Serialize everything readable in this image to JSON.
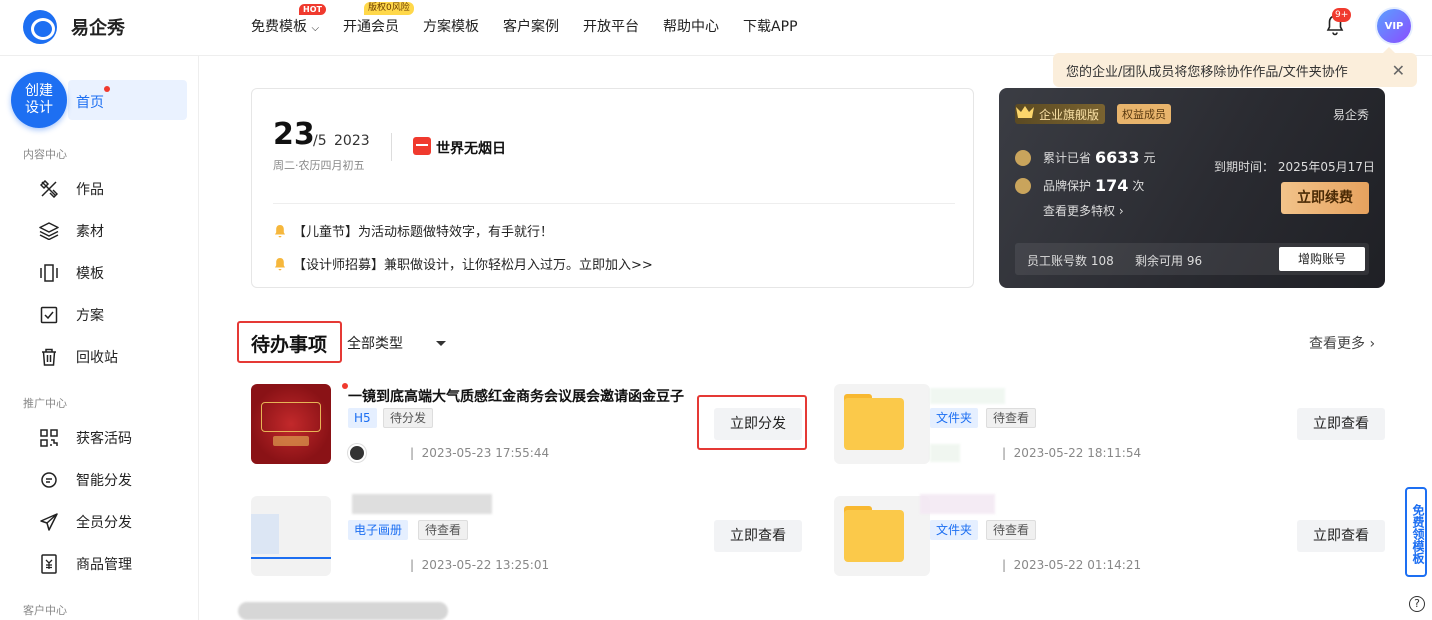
{
  "app": {
    "name": "易企秀"
  },
  "nav": [
    {
      "label": "免费模板",
      "badge": "HOT"
    },
    {
      "label": "开通会员",
      "badge": "版权0风险"
    },
    {
      "label": "方案模板"
    },
    {
      "label": "客户案例"
    },
    {
      "label": "开放平台"
    },
    {
      "label": "帮助中心"
    },
    {
      "label": "下载APP"
    }
  ],
  "header": {
    "bell_badge": "9+",
    "avatar_label": "VIP"
  },
  "tip": {
    "text": "您的企业/团队成员将您移除协作作品/文件夹协作",
    "close": "✕"
  },
  "sidebar": {
    "create_label": "创建设计",
    "create_line1": "创建",
    "create_line2": "设计",
    "home": "首页",
    "sections": [
      {
        "title": "内容中心",
        "items": [
          "作品",
          "素材",
          "模板",
          "方案",
          "回收站"
        ]
      },
      {
        "title": "推广中心",
        "items": [
          "获客活码",
          "智能分发",
          "全员分发",
          "商品管理"
        ]
      },
      {
        "title": "客户中心",
        "items": []
      }
    ]
  },
  "date_card": {
    "day": "23",
    "month": "/5",
    "year": "2023",
    "lunar": "周二·农历四月初五",
    "festival": "世界无烟日",
    "notices": [
      "【儿童节】为活动标题做特效字，有手就行！",
      "【设计师招募】兼职做设计，让你轻松月入过万。立即加入>>"
    ]
  },
  "vip": {
    "tag": "企业旗舰版",
    "tag2": "权益成员",
    "brand": "易企秀",
    "saved_label": "累计已省",
    "saved_value": "6633",
    "saved_unit": "元",
    "protect_label": "品牌保护",
    "protect_value": "174",
    "protect_unit": "次",
    "more": "查看更多特权 ›",
    "expire": "到期时间：  2025年05月17日",
    "renew": "立即续费",
    "staff": "员工账号数 108",
    "remain": "剩余可用 96",
    "buy": "增购账号"
  },
  "todo": {
    "title": "待办事项",
    "type_filter": "全部类型",
    "more": "查看更多 ›",
    "items": [
      {
        "title": "一镜到底高端大气质感红金商务会议展会邀请函金豆子",
        "tags": [
          "H5",
          "待分发"
        ],
        "time": "2023-05-23 17:55:44",
        "action": "立即分发"
      },
      {
        "title": "",
        "tags": [
          "文件夹",
          "待查看"
        ],
        "time": "2023-05-22 18:11:54",
        "action": "立即查看"
      },
      {
        "title": "",
        "tags": [
          "电子画册",
          "待查看"
        ],
        "time": "2023-05-22 13:25:01",
        "action": "立即查看"
      },
      {
        "title": "",
        "tags": [
          "文件夹",
          "待查看"
        ],
        "time": "2023-05-22 01:14:21",
        "action": "立即查看"
      }
    ]
  },
  "float": {
    "free_template": "免费领模板",
    "help": "?"
  },
  "colors": {
    "primary": "#1d6ff2",
    "highlight": "#e53935",
    "gold": "#e6a25e"
  }
}
